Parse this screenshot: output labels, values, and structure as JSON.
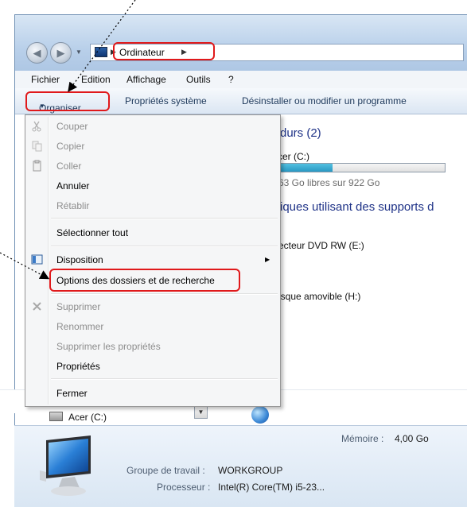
{
  "address": {
    "crumb": "Ordinateur"
  },
  "menubar": {
    "items": [
      "Fichier",
      "Edition",
      "Affichage",
      "Outils",
      "?"
    ]
  },
  "toolbar": {
    "organiser": "Organiser",
    "proprietes_systeme": "Propriétés système",
    "desinstaller": "Désinstaller ou modifier un programme"
  },
  "content": {
    "section_drives": "durs (2)",
    "drive_c_label": "cer (C:)",
    "drive_c_free": "63 Go libres sur 922 Go",
    "drive_c_used_fraction": 0.33,
    "section_removable": "iques utilisant des supports d",
    "drive_dvd": "ecteur DVD RW (E:)",
    "drive_removable": "isque amovible (H:)",
    "nav_acer": "Acer (C:)"
  },
  "details": {
    "memoire_label": "Mémoire :",
    "memoire_value": "4,00 Go",
    "groupe_label": "Groupe de travail :",
    "groupe_value": "WORKGROUP",
    "processeur_label": "Processeur :",
    "processeur_value": "Intel(R) Core(TM) i5-23..."
  },
  "organiser_menu": {
    "couper": "Couper",
    "copier": "Copier",
    "coller": "Coller",
    "annuler": "Annuler",
    "retablir": "Rétablir",
    "selectionner_tout": "Sélectionner tout",
    "disposition": "Disposition",
    "options": "Options des dossiers et de recherche",
    "supprimer": "Supprimer",
    "renommer": "Renommer",
    "supprimer_proprietes": "Supprimer les propriétés",
    "proprietes": "Propriétés",
    "fermer": "Fermer"
  },
  "colors": {
    "highlight_red": "#e0191b",
    "drive_bar": "#2a98c2",
    "section_blue": "#1e3287"
  }
}
